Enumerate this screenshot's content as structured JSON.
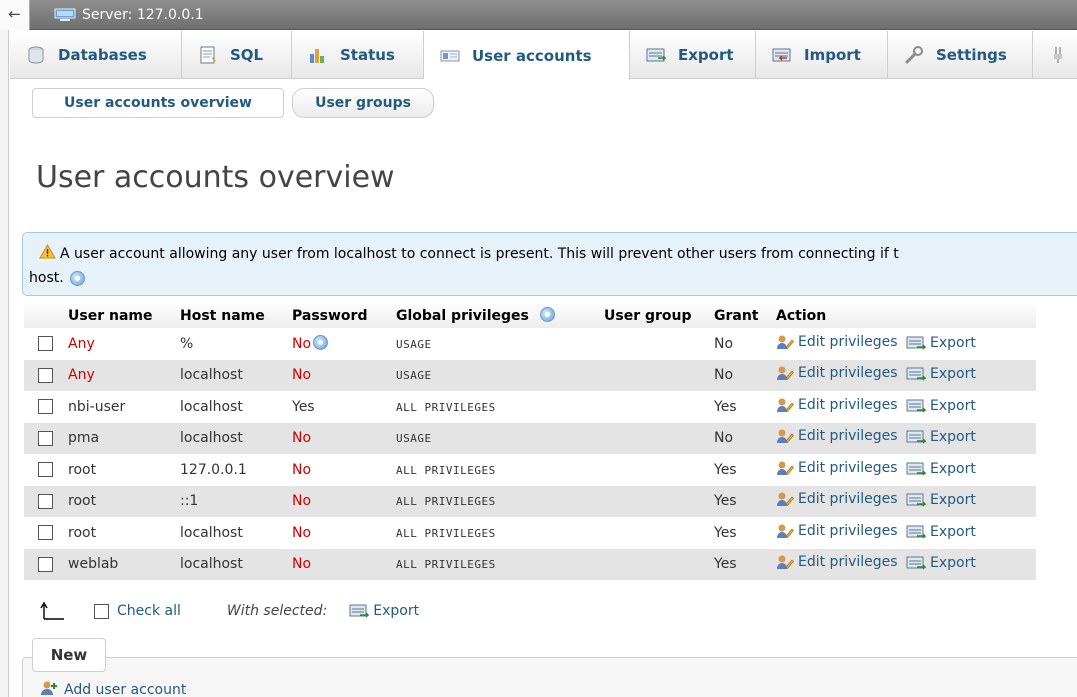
{
  "server_bar": {
    "back_glyph": "←",
    "server_label": "Server: 127.0.0.1"
  },
  "tabs": [
    {
      "label": "Databases",
      "icon": "database-icon",
      "active": false
    },
    {
      "label": "SQL",
      "icon": "sql-icon",
      "active": false
    },
    {
      "label": "Status",
      "icon": "status-chart-icon",
      "active": false
    },
    {
      "label": "User accounts",
      "icon": "user-accounts-icon",
      "active": true
    },
    {
      "label": "Export",
      "icon": "export-icon",
      "active": false
    },
    {
      "label": "Import",
      "icon": "import-icon",
      "active": false
    },
    {
      "label": "Settings",
      "icon": "wrench-icon",
      "active": false
    }
  ],
  "subtabs": [
    {
      "label": "User accounts overview",
      "active": true
    },
    {
      "label": "User groups",
      "active": false
    }
  ],
  "page_title": "User accounts overview",
  "notice": {
    "line1": "A user account allowing any user from localhost to connect is present. This will prevent other users from connecting if t",
    "line2": "host."
  },
  "table": {
    "headers": [
      "User name",
      "Host name",
      "Password",
      "Global privileges",
      "User group",
      "Grant",
      "Action"
    ],
    "rows": [
      {
        "user": "Any",
        "user_red": true,
        "host": "%",
        "password": "No",
        "password_red": true,
        "password_help": true,
        "privileges": "USAGE",
        "group": "",
        "grant": "No",
        "edit": "Edit privileges",
        "export": "Export"
      },
      {
        "user": "Any",
        "user_red": true,
        "host": "localhost",
        "password": "No",
        "password_red": true,
        "password_help": false,
        "privileges": "USAGE",
        "group": "",
        "grant": "No",
        "edit": "Edit privileges",
        "export": "Export"
      },
      {
        "user": "nbi-user",
        "user_red": false,
        "host": "localhost",
        "password": "Yes",
        "password_red": false,
        "password_help": false,
        "privileges": "ALL PRIVILEGES",
        "group": "",
        "grant": "Yes",
        "edit": "Edit privileges",
        "export": "Export"
      },
      {
        "user": "pma",
        "user_red": false,
        "host": "localhost",
        "password": "No",
        "password_red": true,
        "password_help": false,
        "privileges": "USAGE",
        "group": "",
        "grant": "No",
        "edit": "Edit privileges",
        "export": "Export"
      },
      {
        "user": "root",
        "user_red": false,
        "host": "127.0.0.1",
        "password": "No",
        "password_red": true,
        "password_help": false,
        "privileges": "ALL PRIVILEGES",
        "group": "",
        "grant": "Yes",
        "edit": "Edit privileges",
        "export": "Export"
      },
      {
        "user": "root",
        "user_red": false,
        "host": "::1",
        "password": "No",
        "password_red": true,
        "password_help": false,
        "privileges": "ALL PRIVILEGES",
        "group": "",
        "grant": "Yes",
        "edit": "Edit privileges",
        "export": "Export"
      },
      {
        "user": "root",
        "user_red": false,
        "host": "localhost",
        "password": "No",
        "password_red": true,
        "password_help": false,
        "privileges": "ALL PRIVILEGES",
        "group": "",
        "grant": "Yes",
        "edit": "Edit privileges",
        "export": "Export"
      },
      {
        "user": "weblab",
        "user_red": false,
        "host": "localhost",
        "password": "No",
        "password_red": true,
        "password_help": false,
        "privileges": "ALL PRIVILEGES",
        "group": "",
        "grant": "Yes",
        "edit": "Edit privileges",
        "export": "Export"
      }
    ]
  },
  "footer": {
    "check_all": "Check all",
    "with_selected": "With selected:",
    "export": "Export"
  },
  "new_section": {
    "legend": "New",
    "add_user": "Add user account"
  },
  "colors": {
    "link": "#235a81",
    "warning_red": "#d00000",
    "notice_bg": "#e7f1f9",
    "row_alt": "#e4e4e4"
  }
}
